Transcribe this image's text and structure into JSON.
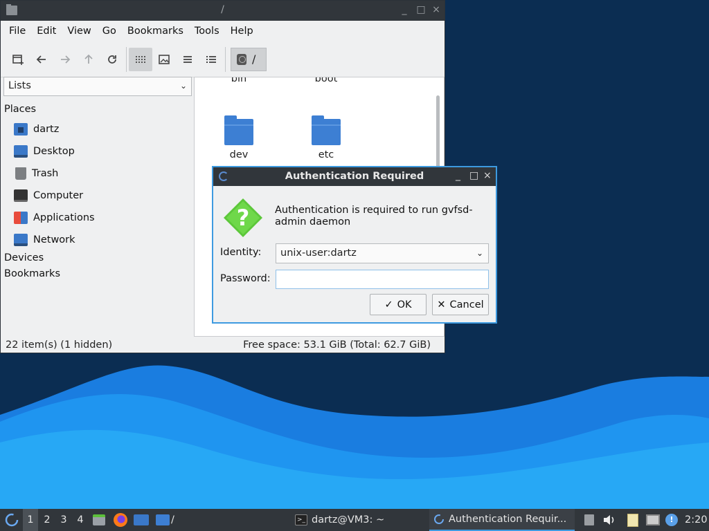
{
  "file_manager": {
    "window_title": "/",
    "window_controls": {
      "minimize": "_",
      "maximize": "□",
      "close": "×"
    },
    "menu": [
      "File",
      "Edit",
      "View",
      "Go",
      "Bookmarks",
      "Tools",
      "Help"
    ],
    "path_label": "/",
    "side_pane_mode": "Lists",
    "places_header": "Places",
    "places": [
      "dartz",
      "Desktop",
      "Trash",
      "Computer",
      "Applications",
      "Network"
    ],
    "devices_header": "Devices",
    "bookmarks_header": "Bookmarks",
    "folders_partial": [
      "bin",
      "boot"
    ],
    "folders": [
      "dev",
      "etc"
    ],
    "status_left": "22 item(s) (1 hidden)",
    "status_right": "Free space: 53.1 GiB (Total: 62.7 GiB)"
  },
  "dialog": {
    "title": "Authentication Required",
    "message": "Authentication is required to run gvfsd-admin daemon",
    "identity_label": "Identity:",
    "identity_value": "unix-user:dartz",
    "password_label": "Password:",
    "password_value": "",
    "ok_label": "OK",
    "cancel_label": "Cancel"
  },
  "taskbar": {
    "workspaces": [
      "1",
      "2",
      "3",
      "4"
    ],
    "terminal_task": "dartz@VM3: ~",
    "auth_task": "Authentication Requir...",
    "folder_launcher_label": "/",
    "clock": "2:20"
  },
  "colors": {
    "accent": "#3d9ae0",
    "titlebar": "#31363b",
    "folder": "#3d7fd3",
    "question_icon": "#5cc73a"
  }
}
